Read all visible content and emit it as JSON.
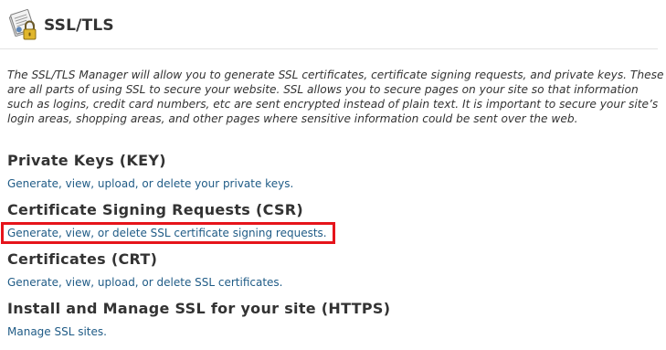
{
  "header": {
    "title": "SSL/TLS",
    "icon": "ssl-certificate-lock-icon"
  },
  "intro": {
    "text": "The SSL/TLS Manager will allow you to generate SSL certificates, certificate signing requests, and private keys. These are all parts of using SSL to secure your website. SSL allows you to secure pages on your site so that information such as logins, credit card numbers, etc are sent encrypted instead of plain text. It is important to secure your site’s login areas, shopping areas, and other pages where sensitive information could be sent over the web."
  },
  "sections": [
    {
      "title": "Private Keys (KEY)",
      "link": "Generate, view, upload, or delete your private keys."
    },
    {
      "title": "Certificate Signing Requests (CSR)",
      "link": "Generate, view, or delete SSL certificate signing requests."
    },
    {
      "title": "Certificates (CRT)",
      "link": "Generate, view, upload, or delete SSL certificates."
    },
    {
      "title": "Install and Manage SSL for your site (HTTPS)",
      "link": "Manage SSL sites."
    }
  ],
  "colors": {
    "link": "#1f5b86",
    "highlight": "#e6141b",
    "text": "#333333"
  }
}
